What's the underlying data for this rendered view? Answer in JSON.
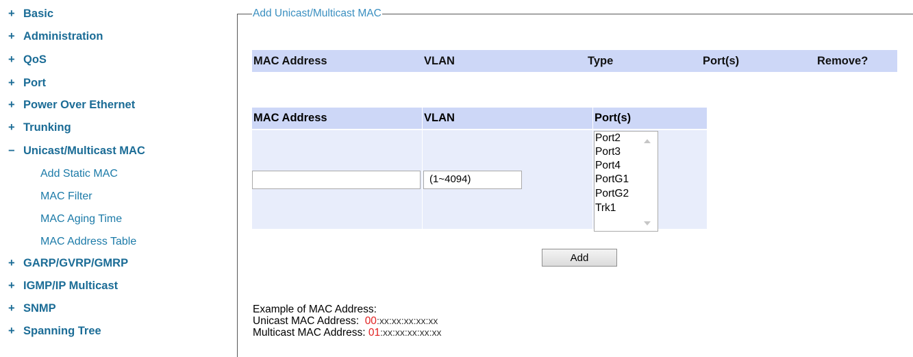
{
  "sidebar": {
    "items": [
      {
        "sign": "+",
        "label": "Basic"
      },
      {
        "sign": "+",
        "label": "Administration"
      },
      {
        "sign": "+",
        "label": "QoS"
      },
      {
        "sign": "+",
        "label": "Port"
      },
      {
        "sign": "+",
        "label": "Power Over Ethernet"
      },
      {
        "sign": "+",
        "label": "Trunking"
      },
      {
        "sign": "−",
        "label": "Unicast/Multicast MAC"
      },
      {
        "sign": "+",
        "label": "GARP/GVRP/GMRP"
      },
      {
        "sign": "+",
        "label": "IGMP/IP Multicast"
      },
      {
        "sign": "+",
        "label": "SNMP"
      },
      {
        "sign": "+",
        "label": "Spanning Tree"
      }
    ],
    "subitems": [
      {
        "label": "Add Static MAC"
      },
      {
        "label": "MAC Filter"
      },
      {
        "label": "MAC Aging Time"
      },
      {
        "label": "MAC Address Table"
      }
    ]
  },
  "section": {
    "legend": "Add Unicast/Multicast MAC"
  },
  "list_table": {
    "headers": [
      "MAC Address",
      "VLAN",
      "Type",
      "Port(s)",
      "Remove?"
    ]
  },
  "add_table": {
    "headers": [
      "MAC Address",
      "VLAN",
      "Port(s)"
    ],
    "mac_value": "",
    "vlan_value": "",
    "vlan_range": "(1~4094)",
    "ports": [
      "Port2",
      "Port3",
      "Port4",
      "PortG1",
      "PortG2",
      "Trk1"
    ]
  },
  "add_button_label": "Add",
  "example": {
    "title": "Example of MAC Address:",
    "unicast_label": "Unicast MAC Address:",
    "unicast_prefix": "00",
    "unicast_suffix": ":xx:xx:xx:xx:xx",
    "multicast_label": "Multicast MAC Address:",
    "multicast_prefix": "01",
    "multicast_suffix": ":xx:xx:xx:xx:xx"
  },
  "colors": {
    "nav_link": "#1b6c96",
    "legend": "#3a8fc0",
    "header_bg": "#cdd7f7",
    "body_bg": "#e8edfb",
    "prefix_red": "#e02020"
  }
}
